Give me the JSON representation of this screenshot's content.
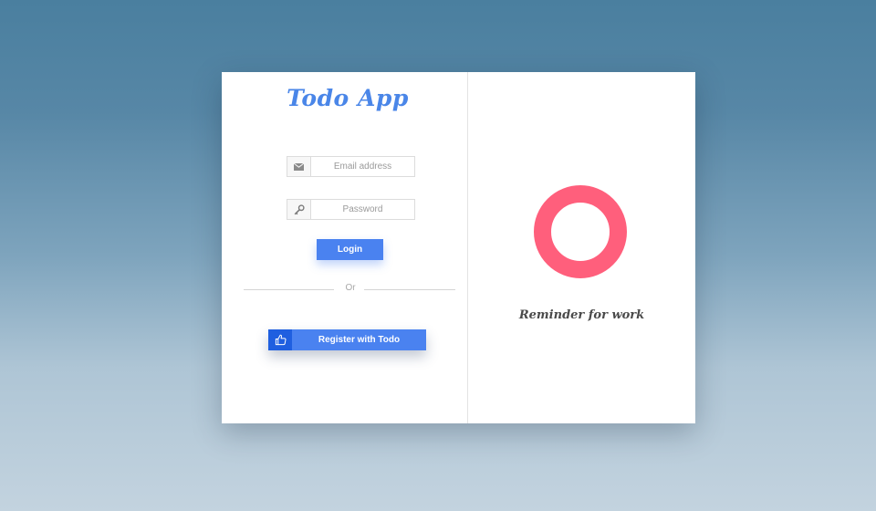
{
  "app": {
    "title": "Todo App"
  },
  "login_form": {
    "email": {
      "placeholder": "Email address",
      "value": "",
      "icon": "envelope-icon"
    },
    "password": {
      "placeholder": "Password",
      "value": "",
      "icon": "key-icon"
    },
    "login_label": "Login",
    "divider_label": "Or",
    "register_label": "Register with Todo",
    "register_icon": "thumbs-up-icon"
  },
  "showcase": {
    "logo_icon": "ring-icon",
    "tagline": "Reminder for work"
  },
  "colors": {
    "accent": "#4a82f0",
    "accent_dark": "#1f5fe0",
    "title": "#4a86e8",
    "ring": "#ff5f7c"
  }
}
